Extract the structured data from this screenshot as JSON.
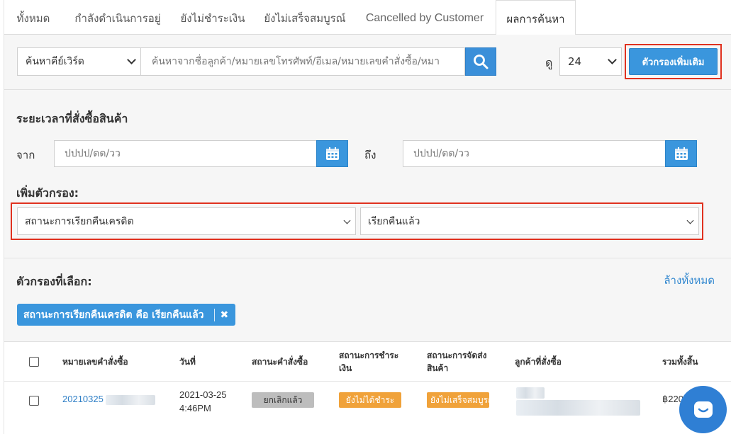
{
  "tabs": [
    {
      "label": "ทั้งหมด"
    },
    {
      "label": "กำลังดำเนินการอยู่"
    },
    {
      "label": "ยังไม่ชำระเงิน"
    },
    {
      "label": "ยังไม่เสร็จสมบูรณ์"
    },
    {
      "label": "Cancelled by Customer"
    },
    {
      "label": "ผลการค้นหา"
    }
  ],
  "search": {
    "keyword_select": "ค้นหาคีย์เวิร์ด",
    "placeholder": "ค้นหาจากชื่อลูกค้า/หมายเลขโทรศัพท์/อีเมล/หมายเลขคำสั่งซื้อ/หมา",
    "view_label": "ดู",
    "page_size": "24",
    "more_filters_label": "ตัวกรองเพิ่มเติม"
  },
  "filters": {
    "order_period_title": "ระยะเวลาที่สั่งซื้อสินค้า",
    "from_label": "จาก",
    "to_label": "ถึง",
    "date_placeholder": "ปปปป/ดด/วว",
    "add_filter_title": "เพิ่มตัวกรอง:",
    "filter_field": "สถานะการเรียกคืนเครดิต",
    "filter_value": "เรียกคืนแล้ว"
  },
  "selected": {
    "title": "ตัวกรองที่เลือก:",
    "clear_all": "ล้างทั้งหมด",
    "chip_label": "สถานะการเรียกคืนเครดิต คือ เรียกคืนแล้ว",
    "chip_remove": "✖"
  },
  "table": {
    "headers": {
      "order_no": "หมายเลขคำสั่งซื้อ",
      "date": "วันที่",
      "order_status": "สถานะคำสั่งซื้อ",
      "payment_status": "สถานะการชำระเงิน",
      "shipping_status": "สถานะการจัดส่งสินค้า",
      "customer": "ลูกค้าที่สั่งซื้อ",
      "total": "รวมทั้งสิ้น"
    },
    "rows": [
      {
        "order_no": "20210325",
        "date": "2021-03-25",
        "time": "4:46PM",
        "order_status": "ยกเลิกแล้ว",
        "payment_status": "ยังไม่ได้ชำระ",
        "shipping_status": "ยังไม่เสร็จสมบูรณ์",
        "total": "฿220"
      }
    ]
  },
  "colors": {
    "primary": "#3a96dd",
    "highlight": "#e0311f",
    "badge_orange": "#f0a23a",
    "badge_grey": "#bdbdbd"
  }
}
